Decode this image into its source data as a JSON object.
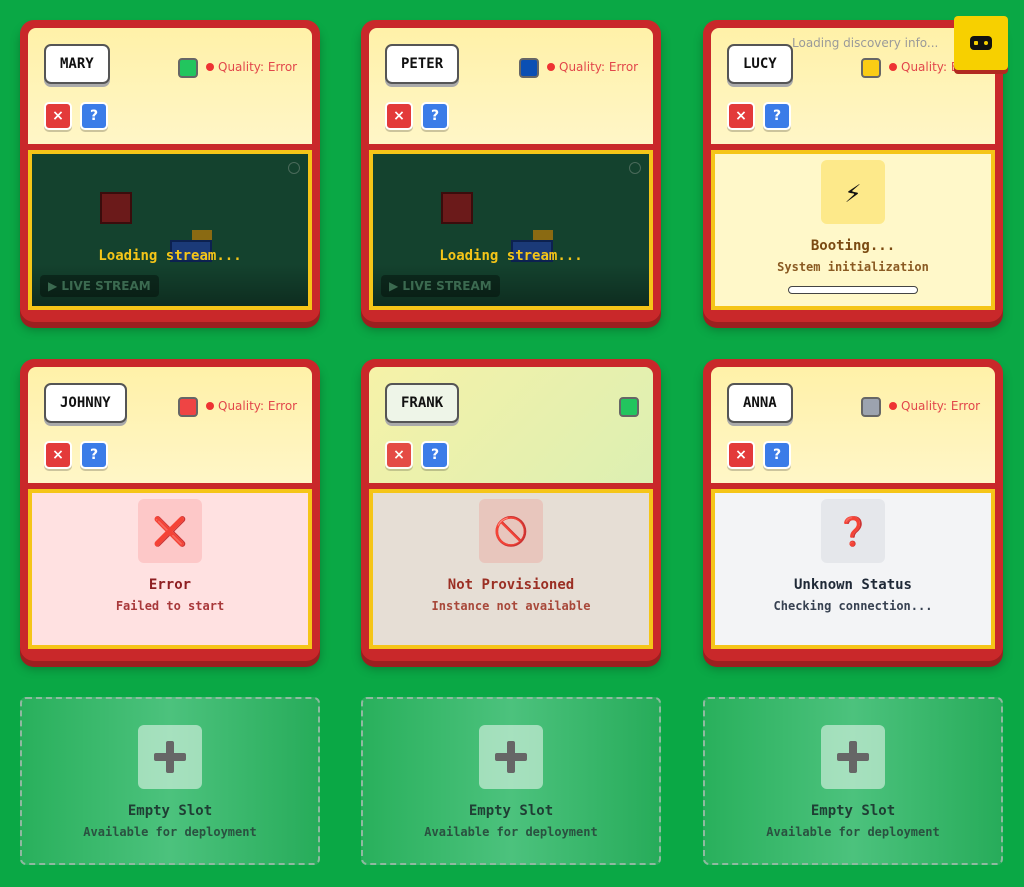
{
  "overlay": {
    "discovery_text": "Loading discovery info..."
  },
  "instances": [
    {
      "name": "MARY",
      "color": "#22c55e",
      "quality": "Quality: Error",
      "close_label": "×",
      "help_label": "?",
      "status": "stream",
      "loading_text": "Loading stream...",
      "live_label": "▶ LIVE STREAM"
    },
    {
      "name": "PETER",
      "color": "#0b4fb3",
      "quality": "Quality: Error",
      "close_label": "×",
      "help_label": "?",
      "status": "stream",
      "loading_text": "Loading stream...",
      "live_label": "▶ LIVE STREAM"
    },
    {
      "name": "LUCY",
      "color": "#facc15",
      "quality": "Quality: E",
      "close_label": "×",
      "help_label": "?",
      "status": "booting",
      "status_icon": "⚡",
      "status_title": "Booting...",
      "status_sub": "System initialization"
    },
    {
      "name": "JOHNNY",
      "color": "#ef4444",
      "quality": "Quality: Error",
      "close_label": "×",
      "help_label": "?",
      "status": "error",
      "status_icon": "❌",
      "status_title": "Error",
      "status_sub": "Failed to start"
    },
    {
      "name": "FRANK",
      "color": "#22c55e",
      "quality": "",
      "close_label": "×",
      "help_label": "?",
      "status": "not-provisioned",
      "status_icon": "🚫",
      "status_title": "Not Provisioned",
      "status_sub": "Instance not available"
    },
    {
      "name": "ANNA",
      "color": "#9ca3af",
      "quality": "Quality: Error",
      "close_label": "×",
      "help_label": "?",
      "status": "unknown",
      "status_icon": "❓",
      "status_title": "Unknown Status",
      "status_sub": "Checking connection..."
    }
  ],
  "empty_slots": [
    {
      "title": "Empty Slot",
      "sub": "Available for deployment"
    },
    {
      "title": "Empty Slot",
      "sub": "Available for deployment"
    },
    {
      "title": "Empty Slot",
      "sub": "Available for deployment"
    }
  ]
}
